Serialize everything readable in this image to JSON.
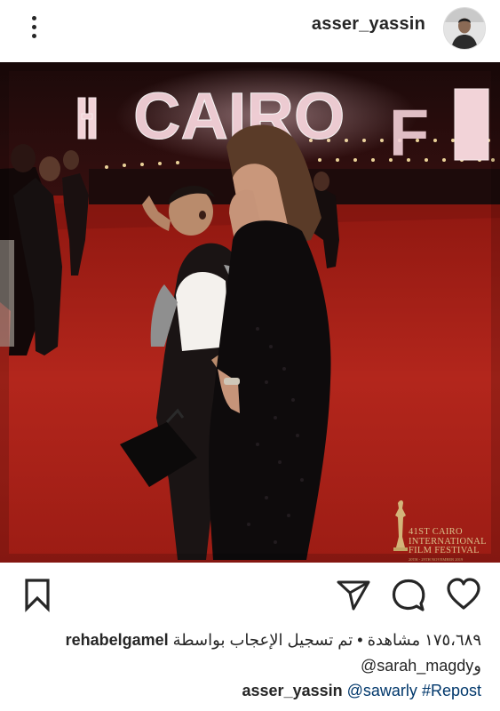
{
  "header": {
    "username": "asser_yassin"
  },
  "media": {
    "backdrop_sign": "CAIRO",
    "festival_logo": {
      "line1": "41ST CAIRO",
      "line2": "INTERNATIONAL",
      "line3": "FILM FESTIVAL",
      "dates": "20TH - 29TH NOVEMBER 2019"
    }
  },
  "actions": {
    "icons": [
      "bookmark-icon",
      "share-icon",
      "comment-icon",
      "heart-icon"
    ]
  },
  "stats": {
    "views_count": "١٧٥،٦٨٩",
    "views_label": "مشاهدة",
    "separator": "•",
    "liked_by_text": "تم تسجيل الإعجاب بواسطة",
    "liked_by_user": "rehabelgamel",
    "and_text": "و",
    "other_user": "sarah_magdy@"
  },
  "post_caption": {
    "username": "asser_yassin",
    "hashtag": "#Repost",
    "mention": "@sawarly"
  },
  "colors": {
    "text": "#262626",
    "link": "#00376b",
    "carpet": "#b0231c"
  }
}
